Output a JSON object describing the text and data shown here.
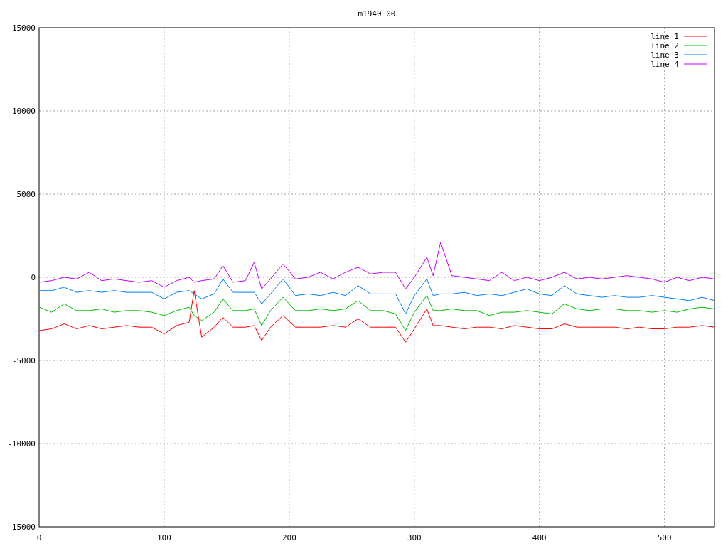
{
  "plot": {
    "chart_data": {
      "type": "line",
      "title": "m1940_00",
      "grid": true,
      "legend": true,
      "xlim": [
        0,
        540
      ],
      "ylim": [
        -15000,
        15000
      ],
      "xticks": [
        0,
        100,
        200,
        300,
        400,
        500
      ],
      "yticks": [
        -15000,
        -10000,
        -5000,
        0,
        5000,
        10000,
        15000
      ],
      "x": [
        0,
        10,
        20,
        30,
        40,
        50,
        60,
        70,
        80,
        90,
        100,
        110,
        120,
        124,
        130,
        140,
        147,
        155,
        165,
        172,
        178,
        185,
        195,
        205,
        215,
        225,
        235,
        245,
        255,
        265,
        275,
        285,
        293,
        300,
        310,
        315,
        321,
        330,
        340,
        350,
        360,
        370,
        380,
        390,
        400,
        410,
        420,
        430,
        440,
        450,
        460,
        470,
        480,
        490,
        500,
        510,
        520,
        530,
        540
      ],
      "series": [
        {
          "name": "line 1",
          "color": "#ff0000",
          "values": [
            -3200,
            -3100,
            -2800,
            -3100,
            -2900,
            -3100,
            -3000,
            -2900,
            -3000,
            -3000,
            -3400,
            -2900,
            -2700,
            -800,
            -3600,
            -3000,
            -2400,
            -3000,
            -3000,
            -2900,
            -3800,
            -3000,
            -2300,
            -3000,
            -3000,
            -3000,
            -2900,
            -3000,
            -2500,
            -3000,
            -3000,
            -3000,
            -3900,
            -3100,
            -1900,
            -2900,
            -2900,
            -3000,
            -3100,
            -3000,
            -3000,
            -3100,
            -2900,
            -3000,
            -3100,
            -3100,
            -2800,
            -3000,
            -3000,
            -3000,
            -3000,
            -3100,
            -3000,
            -3100,
            -3100,
            -3000,
            -3000,
            -2900,
            -3000
          ]
        },
        {
          "name": "line 2",
          "color": "#00c000",
          "values": [
            -1800,
            -2100,
            -1600,
            -2000,
            -2000,
            -1900,
            -2100,
            -2000,
            -2000,
            -2100,
            -2300,
            -2000,
            -1800,
            -2300,
            -2600,
            -2100,
            -1300,
            -2000,
            -2000,
            -1900,
            -2900,
            -2000,
            -1200,
            -2000,
            -2000,
            -1900,
            -2000,
            -1900,
            -1400,
            -2000,
            -2000,
            -2200,
            -3200,
            -2100,
            -1100,
            -2000,
            -2000,
            -1900,
            -2000,
            -2000,
            -2300,
            -2100,
            -2100,
            -2000,
            -2100,
            -2200,
            -1600,
            -1900,
            -2000,
            -1900,
            -1900,
            -2000,
            -2000,
            -2100,
            -2000,
            -2100,
            -1900,
            -1800,
            -1900
          ]
        },
        {
          "name": "line 3",
          "color": "#0080ff",
          "values": [
            -800,
            -800,
            -600,
            -900,
            -800,
            -900,
            -800,
            -900,
            -900,
            -900,
            -1300,
            -900,
            -800,
            -1000,
            -1300,
            -1000,
            -100,
            -900,
            -900,
            -900,
            -1600,
            -1000,
            -100,
            -1100,
            -1000,
            -1100,
            -900,
            -1100,
            -500,
            -1000,
            -1000,
            -1000,
            -2200,
            -1100,
            -100,
            -1100,
            -1000,
            -1000,
            -900,
            -1100,
            -1000,
            -1100,
            -900,
            -700,
            -1000,
            -1100,
            -500,
            -1000,
            -1100,
            -1200,
            -1100,
            -1200,
            -1200,
            -1100,
            -1200,
            -1300,
            -1400,
            -1200,
            -1400
          ]
        },
        {
          "name": "line 4",
          "color": "#c000ff",
          "values": [
            -300,
            -200,
            0,
            -100,
            300,
            -200,
            -100,
            -200,
            -300,
            -200,
            -600,
            -200,
            0,
            -300,
            -200,
            -100,
            700,
            -300,
            -200,
            900,
            -700,
            -100,
            800,
            -100,
            0,
            300,
            -100,
            300,
            600,
            200,
            300,
            300,
            -700,
            0,
            1200,
            100,
            2100,
            100,
            0,
            -100,
            -200,
            300,
            -200,
            0,
            -200,
            0,
            300,
            -100,
            0,
            -100,
            0,
            100,
            0,
            -100,
            -300,
            0,
            -200,
            0,
            -100
          ]
        }
      ]
    }
  }
}
